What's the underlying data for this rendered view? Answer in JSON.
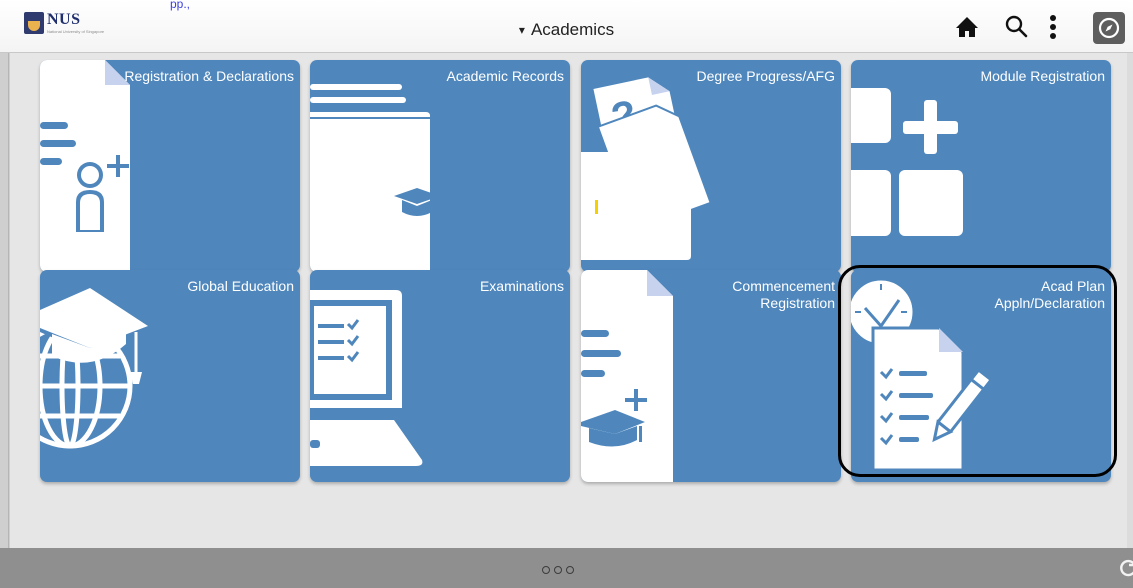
{
  "header": {
    "url_fragment": "pp.,",
    "logo_text": "NUS",
    "logo_subtext": "National University of Singapore",
    "title": "Academics",
    "caret": "▾",
    "icons": [
      "home-icon",
      "search-icon",
      "more-vertical-icon",
      "compass-icon"
    ]
  },
  "tiles": [
    {
      "label": "Registration & Declarations",
      "icon": "document-person-icon"
    },
    {
      "label": "Academic Records",
      "icon": "folder-graduation-cap-icon"
    },
    {
      "label": "Degree Progress/AFG",
      "icon": "documents-folder-icon"
    },
    {
      "label": "Module Registration",
      "icon": "add-grid-icon"
    },
    {
      "label": "Global Education",
      "icon": "globe-graduation-cap-icon"
    },
    {
      "label": "Examinations",
      "icon": "laptop-checklist-icon"
    },
    {
      "label": "Commencement Registration",
      "icon": "document-graduation-cap-icon"
    },
    {
      "label": "Acad Plan Appln/Declaration",
      "icon": "clock-checklist-pencil-icon"
    }
  ],
  "footer": {
    "page_dots": 3,
    "icons": [
      "page-indicator-dots",
      "reload-icon"
    ]
  },
  "colors": {
    "tile": "#4f87bd",
    "tile_fold": "#c7d3ee",
    "icon": "#ffffff",
    "accent": "#f5d000",
    "highlight_outline": "#000000",
    "footer": "#8f8f8f"
  }
}
